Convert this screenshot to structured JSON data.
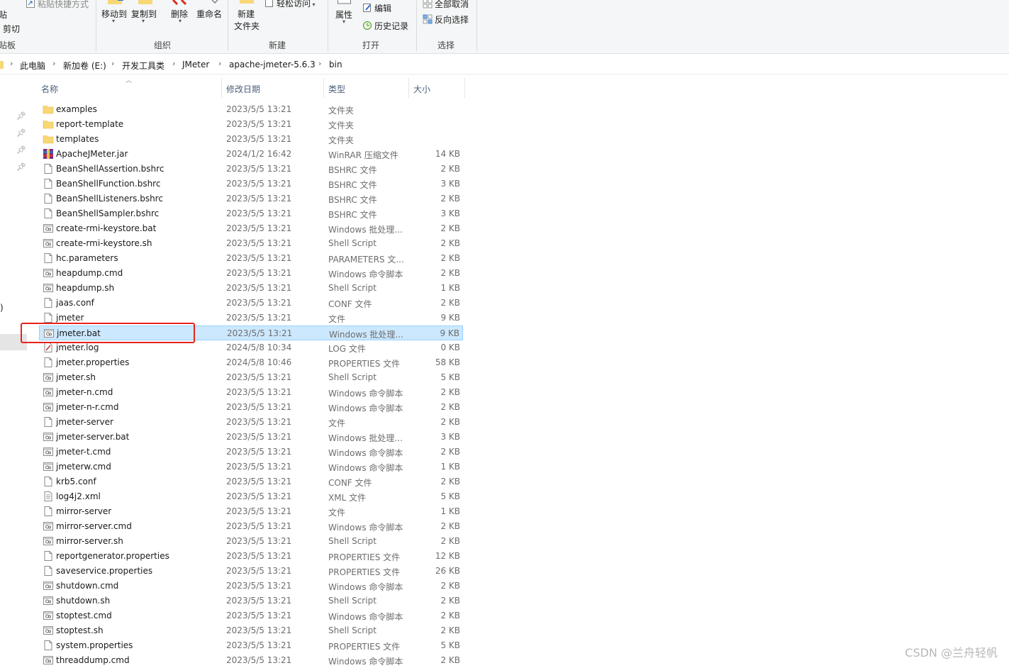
{
  "ribbon": {
    "clipboard": {
      "paste_shortcut": "粘贴快捷方式",
      "cut": "剪切",
      "paste_partial": "贴",
      "group_label": "贴板"
    },
    "organize": {
      "move_to": "移动到",
      "copy_to": "复制到",
      "delete": "删除",
      "rename": "重命名",
      "group_label": "组织"
    },
    "new": {
      "new_folder_line1": "新建",
      "new_folder_line2": "文件夹",
      "easy_access": "轻松访问",
      "group_label": "新建"
    },
    "open": {
      "properties": "属性",
      "edit": "编辑",
      "history": "历史记录",
      "group_label": "打开"
    },
    "select": {
      "select_none": "全部取消",
      "invert_selection": "反向选择",
      "group_label": "选择"
    }
  },
  "breadcrumb": [
    "此电脑",
    "新加卷 (E:)",
    "开发工具类",
    "JMeter",
    "apache-jmeter-5.6.3",
    "bin"
  ],
  "nav": {
    "partial_text": ")"
  },
  "columns": {
    "name": "名称",
    "date": "修改日期",
    "type": "类型",
    "size": "大小"
  },
  "files": [
    {
      "name": "examples",
      "date": "2023/5/5 13:21",
      "type": "文件夹",
      "size": "",
      "icon": "folder-icon"
    },
    {
      "name": "report-template",
      "date": "2023/5/5 13:21",
      "type": "文件夹",
      "size": "",
      "icon": "folder-icon"
    },
    {
      "name": "templates",
      "date": "2023/5/5 13:21",
      "type": "文件夹",
      "size": "",
      "icon": "folder-icon"
    },
    {
      "name": "ApacheJMeter.jar",
      "date": "2024/1/2 16:42",
      "type": "WinRAR 压缩文件",
      "size": "14 KB",
      "icon": "winrar-icon"
    },
    {
      "name": "BeanShellAssertion.bshrc",
      "date": "2023/5/5 13:21",
      "type": "BSHRC 文件",
      "size": "2 KB",
      "icon": "file-icon"
    },
    {
      "name": "BeanShellFunction.bshrc",
      "date": "2023/5/5 13:21",
      "type": "BSHRC 文件",
      "size": "3 KB",
      "icon": "file-icon"
    },
    {
      "name": "BeanShellListeners.bshrc",
      "date": "2023/5/5 13:21",
      "type": "BSHRC 文件",
      "size": "2 KB",
      "icon": "file-icon"
    },
    {
      "name": "BeanShellSampler.bshrc",
      "date": "2023/5/5 13:21",
      "type": "BSHRC 文件",
      "size": "3 KB",
      "icon": "file-icon"
    },
    {
      "name": "create-rmi-keystore.bat",
      "date": "2023/5/5 13:21",
      "type": "Windows 批处理...",
      "size": "2 KB",
      "icon": "script-icon"
    },
    {
      "name": "create-rmi-keystore.sh",
      "date": "2023/5/5 13:21",
      "type": "Shell Script",
      "size": "2 KB",
      "icon": "script-icon"
    },
    {
      "name": "hc.parameters",
      "date": "2023/5/5 13:21",
      "type": "PARAMETERS 文...",
      "size": "2 KB",
      "icon": "file-icon"
    },
    {
      "name": "heapdump.cmd",
      "date": "2023/5/5 13:21",
      "type": "Windows 命令脚本",
      "size": "2 KB",
      "icon": "script-icon"
    },
    {
      "name": "heapdump.sh",
      "date": "2023/5/5 13:21",
      "type": "Shell Script",
      "size": "1 KB",
      "icon": "script-icon"
    },
    {
      "name": "jaas.conf",
      "date": "2023/5/5 13:21",
      "type": "CONF 文件",
      "size": "2 KB",
      "icon": "file-icon"
    },
    {
      "name": "jmeter",
      "date": "2023/5/5 13:21",
      "type": "文件",
      "size": "9 KB",
      "icon": "file-icon"
    },
    {
      "name": "jmeter.bat",
      "date": "2023/5/5 13:21",
      "type": "Windows 批处理...",
      "size": "9 KB",
      "icon": "script-icon"
    },
    {
      "name": "jmeter.log",
      "date": "2024/5/8 10:34",
      "type": "LOG 文件",
      "size": "0 KB",
      "icon": "log-icon"
    },
    {
      "name": "jmeter.properties",
      "date": "2024/5/8 10:46",
      "type": "PROPERTIES 文件",
      "size": "58 KB",
      "icon": "file-icon"
    },
    {
      "name": "jmeter.sh",
      "date": "2023/5/5 13:21",
      "type": "Shell Script",
      "size": "5 KB",
      "icon": "script-icon"
    },
    {
      "name": "jmeter-n.cmd",
      "date": "2023/5/5 13:21",
      "type": "Windows 命令脚本",
      "size": "2 KB",
      "icon": "script-icon"
    },
    {
      "name": "jmeter-n-r.cmd",
      "date": "2023/5/5 13:21",
      "type": "Windows 命令脚本",
      "size": "2 KB",
      "icon": "script-icon"
    },
    {
      "name": "jmeter-server",
      "date": "2023/5/5 13:21",
      "type": "文件",
      "size": "2 KB",
      "icon": "file-icon"
    },
    {
      "name": "jmeter-server.bat",
      "date": "2023/5/5 13:21",
      "type": "Windows 批处理...",
      "size": "3 KB",
      "icon": "script-icon"
    },
    {
      "name": "jmeter-t.cmd",
      "date": "2023/5/5 13:21",
      "type": "Windows 命令脚本",
      "size": "2 KB",
      "icon": "script-icon"
    },
    {
      "name": "jmeterw.cmd",
      "date": "2023/5/5 13:21",
      "type": "Windows 命令脚本",
      "size": "1 KB",
      "icon": "script-icon"
    },
    {
      "name": "krb5.conf",
      "date": "2023/5/5 13:21",
      "type": "CONF 文件",
      "size": "2 KB",
      "icon": "file-icon"
    },
    {
      "name": "log4j2.xml",
      "date": "2023/5/5 13:21",
      "type": "XML 文件",
      "size": "5 KB",
      "icon": "xml-icon"
    },
    {
      "name": "mirror-server",
      "date": "2023/5/5 13:21",
      "type": "文件",
      "size": "1 KB",
      "icon": "file-icon"
    },
    {
      "name": "mirror-server.cmd",
      "date": "2023/5/5 13:21",
      "type": "Windows 命令脚本",
      "size": "2 KB",
      "icon": "script-icon"
    },
    {
      "name": "mirror-server.sh",
      "date": "2023/5/5 13:21",
      "type": "Shell Script",
      "size": "2 KB",
      "icon": "script-icon"
    },
    {
      "name": "reportgenerator.properties",
      "date": "2023/5/5 13:21",
      "type": "PROPERTIES 文件",
      "size": "12 KB",
      "icon": "file-icon"
    },
    {
      "name": "saveservice.properties",
      "date": "2023/5/5 13:21",
      "type": "PROPERTIES 文件",
      "size": "26 KB",
      "icon": "file-icon"
    },
    {
      "name": "shutdown.cmd",
      "date": "2023/5/5 13:21",
      "type": "Windows 命令脚本",
      "size": "2 KB",
      "icon": "script-icon"
    },
    {
      "name": "shutdown.sh",
      "date": "2023/5/5 13:21",
      "type": "Shell Script",
      "size": "2 KB",
      "icon": "script-icon"
    },
    {
      "name": "stoptest.cmd",
      "date": "2023/5/5 13:21",
      "type": "Windows 命令脚本",
      "size": "2 KB",
      "icon": "script-icon"
    },
    {
      "name": "stoptest.sh",
      "date": "2023/5/5 13:21",
      "type": "Shell Script",
      "size": "2 KB",
      "icon": "script-icon"
    },
    {
      "name": "system.properties",
      "date": "2023/5/5 13:21",
      "type": "PROPERTIES 文件",
      "size": "5 KB",
      "icon": "file-icon"
    },
    {
      "name": "threaddump.cmd",
      "date": "2023/5/5 13:21",
      "type": "Windows 命令脚本",
      "size": "2 KB",
      "icon": "script-icon"
    }
  ],
  "selected_file": "jmeter.bat",
  "watermark": "CSDN @兰舟轻帆",
  "colors": {
    "selection_bg": "#cce8ff",
    "selection_border": "#99d1ff",
    "highlight_box": "#e8221c",
    "folder": "#f8d775",
    "header_text": "#4c607a"
  }
}
